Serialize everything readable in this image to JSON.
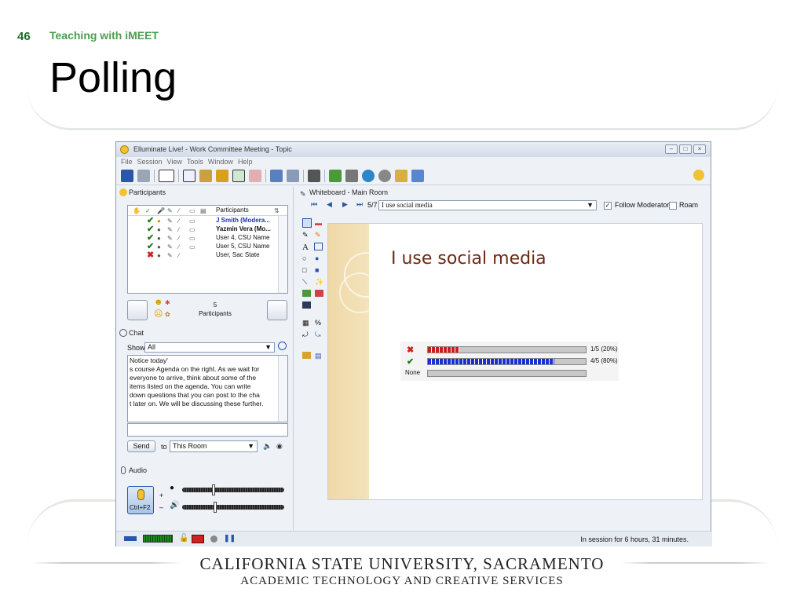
{
  "slide": {
    "number": "46",
    "subtitle": "Teaching with iMEET",
    "title": "Polling",
    "footer_line1": "CALIFORNIA STATE UNIVERSITY, SACRAMENTO",
    "footer_line2": "ACADEMIC TECHNOLOGY AND CREATIVE SERVICES"
  },
  "app": {
    "window_title": "Elluminate Live! - Work Committee Meeting - Topic",
    "menu": [
      "File",
      "Session",
      "View",
      "Tools",
      "Window",
      "Help"
    ],
    "participants": {
      "header": "Participants",
      "column_label": "Participants",
      "rows": [
        {
          "name": "J Smith (Modera...",
          "status": "moderator"
        },
        {
          "name": "Yazmin Vera (Mo...",
          "status": "check"
        },
        {
          "name": "User 4, CSU Name",
          "status": "check"
        },
        {
          "name": "User 5, CSU Name",
          "status": "check"
        },
        {
          "name": "User, Sac State",
          "status": "x"
        }
      ],
      "count": "5",
      "count_label": "Participants"
    },
    "chat": {
      "header": "Chat",
      "show_label": "Show",
      "show_value": "All",
      "lines": [
        "Notice today'",
        "s course Agenda on the right.  As we wait for",
        "everyone to arrive, think about some of the",
        "items listed on the agenda.  You can write",
        "down questions that you can post to the cha",
        "t later on. We will be discussing these further."
      ],
      "input_value": "",
      "send_label": "Send",
      "to_label": "to",
      "to_value": "This Room"
    },
    "audio": {
      "header": "Audio",
      "talk_button": "Ctrl+F2"
    },
    "whiteboard": {
      "header": "Whiteboard - Main Room",
      "page": "5/7",
      "page_select": "I use social media",
      "follow_label": "Follow Moderator",
      "follow_checked": true,
      "roam_label": "Roam",
      "roam_checked": false,
      "slide_title": "I use social media",
      "poll": [
        {
          "symbol": "x",
          "label": "",
          "result": "1/5 (20%)",
          "fraction": 0.2,
          "color": "#d11a1a"
        },
        {
          "symbol": "check",
          "label": "",
          "result": "4/5 (80%)",
          "fraction": 0.8,
          "color": "#1a2fd6"
        },
        {
          "symbol": "none",
          "label": "None",
          "result": "",
          "fraction": 0,
          "color": "#c8c8c8"
        }
      ]
    },
    "status": "In session for 6 hours, 31 minutes."
  }
}
